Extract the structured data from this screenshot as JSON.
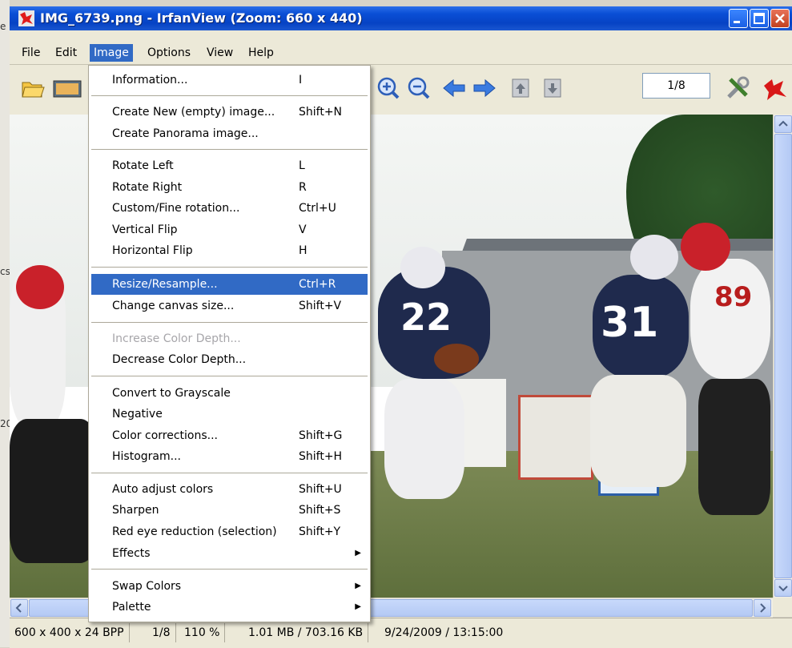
{
  "window": {
    "title": "IMG_6739.png - IrfanView (Zoom: 660 x 440)"
  },
  "menubar": {
    "items": [
      "File",
      "Edit",
      "Image",
      "Options",
      "View",
      "Help"
    ],
    "active": "Image"
  },
  "toolbar": {
    "page_indicator": "1/8"
  },
  "image_menu": {
    "groups": [
      [
        {
          "label": "Information...",
          "shortcut": "I"
        }
      ],
      [
        {
          "label": "Create New (empty) image...",
          "shortcut": "Shift+N"
        },
        {
          "label": "Create Panorama image...",
          "shortcut": ""
        }
      ],
      [
        {
          "label": "Rotate Left",
          "shortcut": "L"
        },
        {
          "label": "Rotate Right",
          "shortcut": "R"
        },
        {
          "label": "Custom/Fine rotation...",
          "shortcut": "Ctrl+U"
        },
        {
          "label": "Vertical Flip",
          "shortcut": "V"
        },
        {
          "label": "Horizontal Flip",
          "shortcut": "H"
        }
      ],
      [
        {
          "label": "Resize/Resample...",
          "shortcut": "Ctrl+R",
          "highlighted": true
        },
        {
          "label": "Change canvas size...",
          "shortcut": "Shift+V"
        }
      ],
      [
        {
          "label": "Increase Color Depth...",
          "shortcut": "",
          "disabled": true
        },
        {
          "label": "Decrease Color Depth...",
          "shortcut": ""
        }
      ],
      [
        {
          "label": "Convert to Grayscale",
          "shortcut": ""
        },
        {
          "label": "Negative",
          "shortcut": ""
        },
        {
          "label": "Color corrections...",
          "shortcut": "Shift+G"
        },
        {
          "label": "Histogram...",
          "shortcut": "Shift+H"
        }
      ],
      [
        {
          "label": "Auto adjust colors",
          "shortcut": "Shift+U"
        },
        {
          "label": "Sharpen",
          "shortcut": "Shift+S"
        },
        {
          "label": "Red eye reduction (selection)",
          "shortcut": "Shift+Y"
        },
        {
          "label": "Effects",
          "shortcut": "",
          "submenu": true
        }
      ],
      [
        {
          "label": "Swap Colors",
          "shortcut": "",
          "submenu": true
        },
        {
          "label": "Palette",
          "shortcut": "",
          "submenu": true
        }
      ]
    ]
  },
  "statusbar": {
    "cells": [
      "600 x 400 x 24 BPP",
      "1/8",
      "110 %",
      "1.01 MB / 703.16 KB",
      "9/24/2009 / 13:15:00"
    ]
  },
  "photo_text": {
    "jersey_22": "22",
    "jersey_31": "31",
    "jersey_89": "89"
  },
  "left_strip": [
    "e",
    "cs",
    "20"
  ],
  "colors": {
    "menu_highlight": "#316ac5",
    "titlebar": "#0643c4",
    "chrome": "#ece9d8"
  },
  "icons": [
    "open-folder-icon",
    "thumbnails-icon",
    "zoom-in-icon",
    "zoom-out-icon",
    "previous-icon",
    "next-icon",
    "first-page-icon",
    "last-page-icon",
    "settings-tools-icon",
    "irfanview-cat-icon"
  ]
}
